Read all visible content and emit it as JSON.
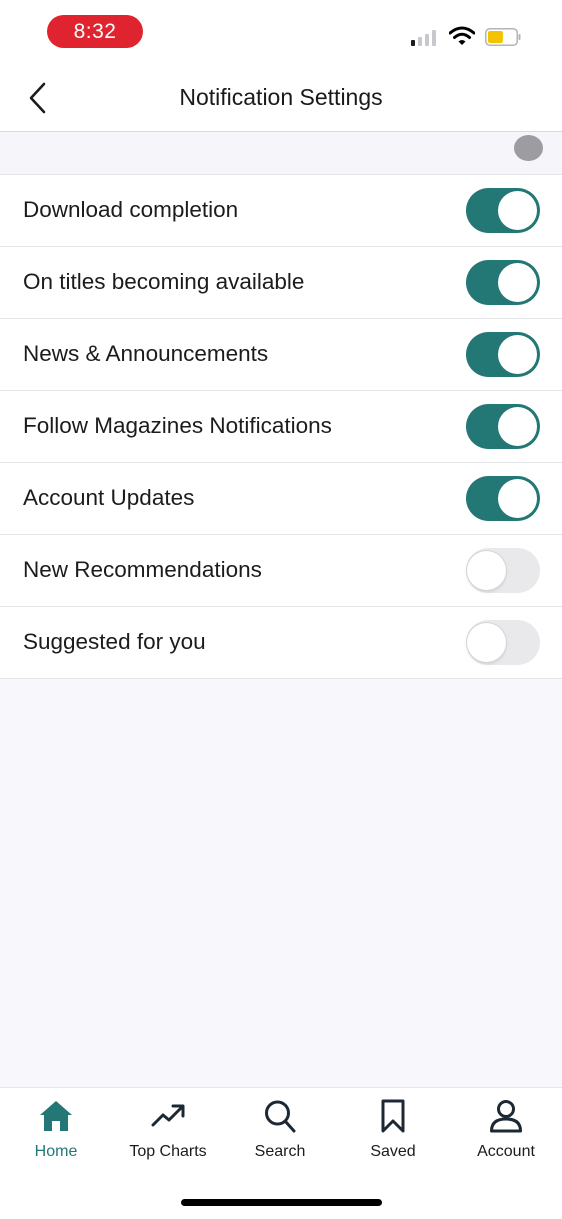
{
  "status_bar": {
    "time": "8:32",
    "signal_bars_active": 1,
    "signal_bars_total": 4,
    "battery_level": 0.55,
    "battery_color": "#f2c400",
    "time_pill_color": "#e0242f"
  },
  "nav": {
    "title": "Notification Settings",
    "back_icon": "chevron-left-icon"
  },
  "accent_color": "#237875",
  "settings": [
    {
      "label": "Download completion",
      "enabled": true
    },
    {
      "label": "On titles becoming available",
      "enabled": true
    },
    {
      "label": "News & Announcements",
      "enabled": true
    },
    {
      "label": "Follow Magazines Notifications",
      "enabled": true
    },
    {
      "label": "Account Updates",
      "enabled": true
    },
    {
      "label": "New Recommendations",
      "enabled": false
    },
    {
      "label": "Suggested for you",
      "enabled": false
    }
  ],
  "tab_bar": {
    "active": "home",
    "tabs": [
      {
        "id": "home",
        "label": "Home",
        "icon": "home-icon"
      },
      {
        "id": "top-charts",
        "label": "Top Charts",
        "icon": "trending-up-icon"
      },
      {
        "id": "search",
        "label": "Search",
        "icon": "search-icon"
      },
      {
        "id": "saved",
        "label": "Saved",
        "icon": "bookmark-icon"
      },
      {
        "id": "account",
        "label": "Account",
        "icon": "user-icon"
      }
    ]
  }
}
